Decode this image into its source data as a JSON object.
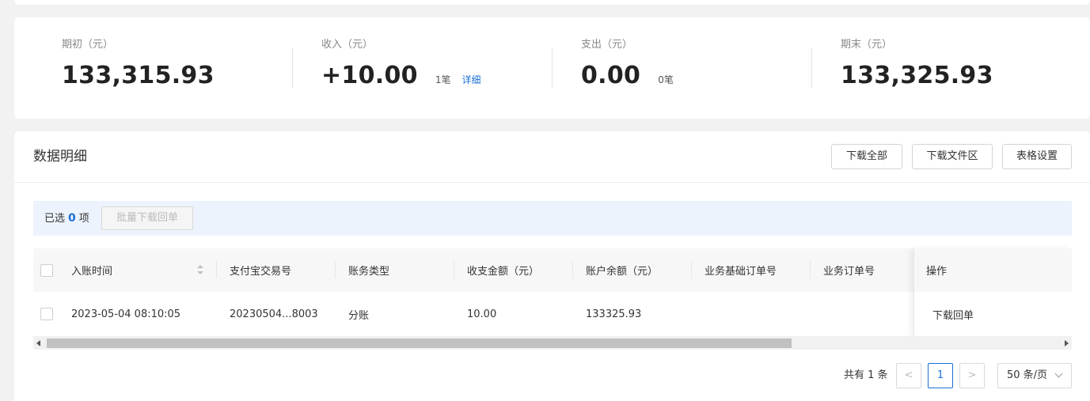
{
  "summary": {
    "opening": {
      "label": "期初（元）",
      "value": "133,315.93"
    },
    "income": {
      "label": "收入（元）",
      "value": "+10.00",
      "count": "1笔",
      "detail_link": "详细"
    },
    "expense": {
      "label": "支出（元）",
      "value": "0.00",
      "count": "0笔"
    },
    "closing": {
      "label": "期末（元）",
      "value": "133,325.93"
    }
  },
  "detail": {
    "title": "数据明细",
    "buttons": {
      "download_all": "下载全部",
      "download_files": "下载文件区",
      "table_settings": "表格设置"
    },
    "selection": {
      "prefix": "已选",
      "count": "0",
      "suffix": "项",
      "batch_button": "批量下载回单"
    },
    "table": {
      "columns": [
        "入账时间",
        "支付宝交易号",
        "账务类型",
        "收支金额（元）",
        "账户余额（元）",
        "业务基础订单号",
        "业务订单号",
        "操作"
      ],
      "rows": [
        {
          "time": "2023-05-04 08:10:05",
          "trade_no": "20230504...8003",
          "type": "分账",
          "amount": "10.00",
          "balance": "133325.93",
          "base_order": "",
          "order": "",
          "action": "下载回单"
        }
      ]
    },
    "pagination": {
      "total": "共有 1 条",
      "current_page": "1",
      "prev": "<",
      "next": ">",
      "page_size": "50 条/页"
    }
  },
  "colors": {
    "accent": "#1b6fd6",
    "selection_bar": "#edf3fd"
  }
}
